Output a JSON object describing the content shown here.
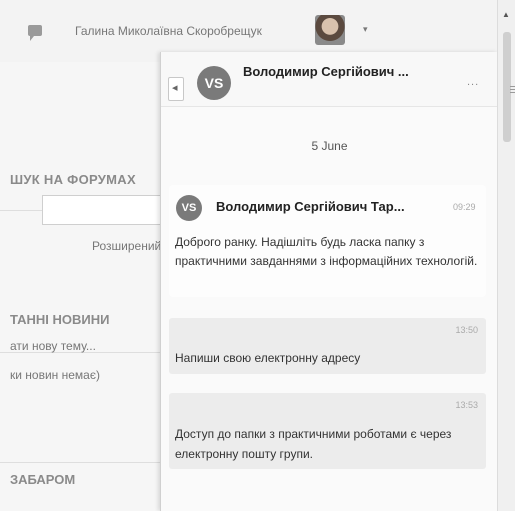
{
  "topbar": {
    "message_icon": "chat-bubble-icon",
    "user_name": "Галина Миколаївна Скоробрещук",
    "caret": "▾"
  },
  "left": {
    "search_title": "ШУК НА ФОРУМАХ",
    "advanced_search": "Розширений",
    "news_title": "ТАННІ НОВИНИ",
    "news_add": "ати нову тему...",
    "news_none": "ки новин немає)",
    "coming_title": "ЗАБАРОМ"
  },
  "chat": {
    "back_glyph": "◂",
    "header_initials": "VS",
    "header_name": "Володимир Сергійович ...",
    "more_label": "...",
    "date": "5 June",
    "messages": [
      {
        "initials": "VS",
        "sender": "Володимир Сергійович Тар...",
        "time": "09:29",
        "text": "Доброго ранку. Надішліть будь ласка папку з практичними завданнями з інформаційних технологій."
      },
      {
        "time": "13:50",
        "text": "Напиши свою електронну адресу"
      },
      {
        "time": "13:53",
        "text": "Доступ до папки з практичними роботами є через електронну пошту групи."
      }
    ]
  },
  "scrollbar": {
    "up_glyph": "▲"
  }
}
